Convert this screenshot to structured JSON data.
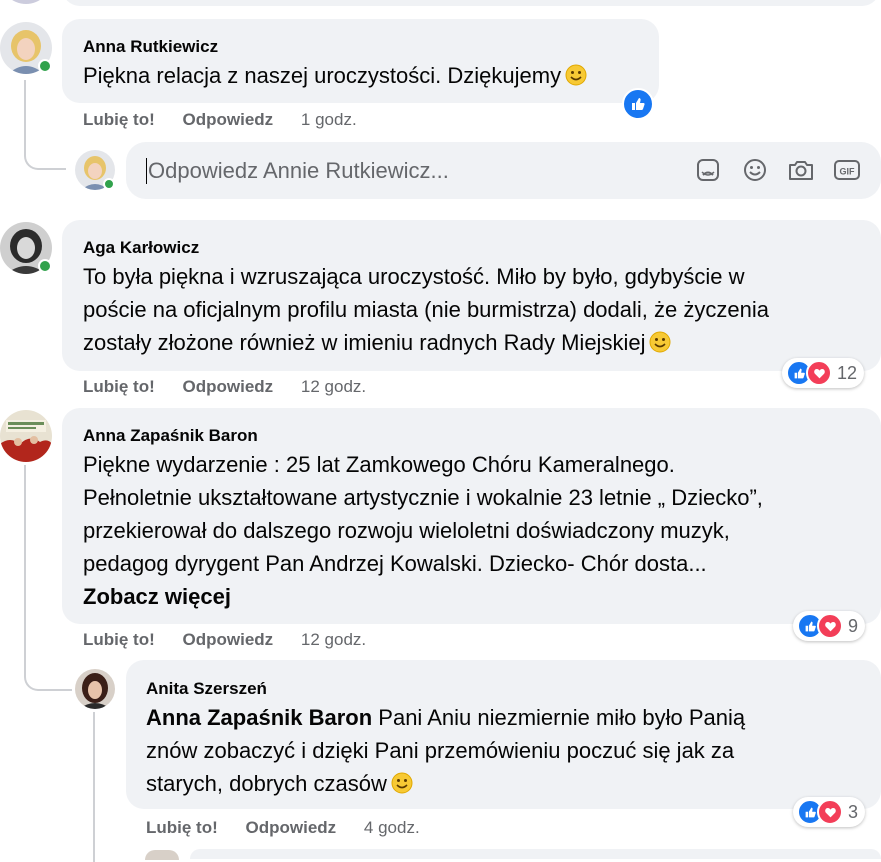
{
  "comments": [
    {
      "author": "Anna Rutkiewicz",
      "text": "Piękna relacja z naszej uroczystości. Dziękujemy",
      "like_label": "Lubię to!",
      "reply_label": "Odpowiedz",
      "time": "1 godz."
    },
    {
      "author": "Aga Karłowicz",
      "text_lines": [
        "To była piękna i wzruszająca uroczystość. Miło by było, gdybyście w",
        "poście na oficjalnym profilu miasta (nie burmistrza) dodali, że życzenia",
        "zostały złożone również w imieniu radnych Rady Miejskiej"
      ],
      "like_label": "Lubię to!",
      "reply_label": "Odpowiedz",
      "time": "12 godz.",
      "reaction_count": "12"
    },
    {
      "author": "Anna Zapaśnik Baron",
      "text_lines": [
        "Piękne wydarzenie : 25 lat Zamkowego Chóru Kameralnego.",
        "Pełnoletnie ukształtowane artystycznie i wokalnie 23 letnie „ Dziecko”,",
        "przekierował do dalszego rozwoju wieloletni doświadczony muzyk,",
        "pedagog dyrygent Pan Andrzej Kowalski. Dziecko- Chór dosta..."
      ],
      "see_more": "Zobacz więcej",
      "like_label": "Lubię to!",
      "reply_label": "Odpowiedz",
      "time": "12 godz.",
      "reaction_count": "9"
    }
  ],
  "reply_composer": {
    "placeholder": "Odpowiedz Annie Rutkiewicz..."
  },
  "reply": {
    "author": "Anita Szerszeń",
    "mention": "Anna Zapaśnik Baron",
    "text_first": "Pani Aniu niezmiernie miło było Panią",
    "text_lines": [
      "znów zobaczyć i dzięki Pani przemówieniu poczuć się jak za",
      "starych, dobrych czasów"
    ],
    "like_label": "Lubię to!",
    "reply_label": "Odpowiedz",
    "time": "4 godz.",
    "reaction_count": "3"
  },
  "colors": {
    "bubble": "#f0f2f5",
    "like_blue": "#1877f2",
    "love_red": "#f33e58",
    "online_green": "#31a24c",
    "muted_text": "#65676b"
  },
  "icons": [
    "like-reaction-icon",
    "love-reaction-icon",
    "smile-emoji-icon",
    "sticker-icon",
    "emoji-icon",
    "camera-icon",
    "gif-icon"
  ]
}
